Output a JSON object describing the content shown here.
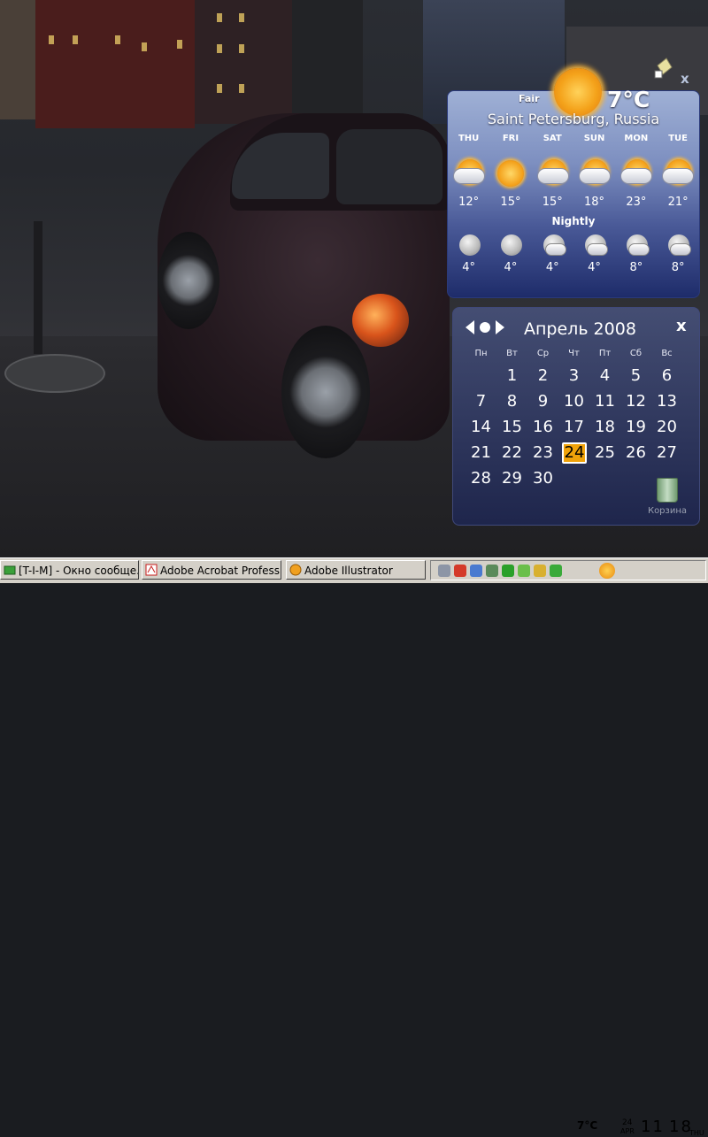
{
  "colors": {
    "weather_gradient_top": "#9fb0d5",
    "weather_gradient_bottom": "#1e2c6a",
    "calendar_bg": "#2a3270",
    "today_highlight": "#f0a20a",
    "taskbar": "#d4d0c8"
  },
  "weather": {
    "condition": "Fair",
    "temperature": "7°C",
    "city": "Saint Petersburg, Russia",
    "days": [
      {
        "day": "THU",
        "high": "12°",
        "low": "4°",
        "day_icon": "sun-cloud-icon",
        "night_icon": "moon-icon"
      },
      {
        "day": "FRI",
        "high": "15°",
        "low": "4°",
        "day_icon": "sun-icon",
        "night_icon": "moon-icon"
      },
      {
        "day": "SAT",
        "high": "15°",
        "low": "4°",
        "day_icon": "sun-cloud-icon",
        "night_icon": "moon-cloud-icon"
      },
      {
        "day": "SUN",
        "high": "18°",
        "low": "4°",
        "day_icon": "sun-cloud-icon",
        "night_icon": "moon-cloud-icon"
      },
      {
        "day": "MON",
        "high": "23°",
        "low": "8°",
        "day_icon": "sun-cloud-icon",
        "night_icon": "moon-cloud-icon"
      },
      {
        "day": "TUE",
        "high": "21°",
        "low": "8°",
        "day_icon": "sun-cloud-icon",
        "night_icon": "moon-cloud-icon"
      }
    ],
    "nightly_label": "Nightly"
  },
  "calendar": {
    "title": "Апрель 2008",
    "close_label": "x",
    "weekdays": [
      "Пн",
      "Вт",
      "Ср",
      "Чт",
      "Пт",
      "Сб",
      "Вс"
    ],
    "first_weekday_offset": 1,
    "days_in_month": 30,
    "today": 24
  },
  "desktop": {
    "recycle_bin_label": "Корзина"
  },
  "taskbar": {
    "buttons": [
      {
        "label": "[T-I-M] - Окно сообще...",
        "icon": "chat-window-icon"
      },
      {
        "label": "Adobe Acrobat Profess...",
        "icon": "acrobat-icon"
      },
      {
        "label": "Adobe Illustrator",
        "icon": "illustrator-icon"
      }
    ],
    "tray": {
      "temperature": "7°C",
      "date_day": "24",
      "date_month": "APR",
      "clock_hour": "11",
      "clock_minute": "18",
      "clock_weekday": "THU"
    }
  }
}
